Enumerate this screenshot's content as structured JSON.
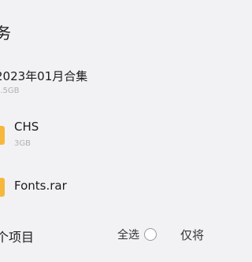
{
  "header": {
    "title": "务"
  },
  "files": [
    {
      "name": "2023年01月合集",
      "size": "7.5GB",
      "icon": "folder-icon"
    },
    {
      "name": "CHS",
      "size": "3GB",
      "icon": "folder-icon"
    },
    {
      "name": "Fonts.rar",
      "size": "",
      "icon": "folder-icon"
    }
  ],
  "footer": {
    "count_label": "个项目",
    "select_all_label": "全选",
    "only_label": "仅将"
  },
  "colors": {
    "background": "#f2f2f4",
    "folder": "#f6b73c",
    "secondary_text": "#b0b0b4"
  }
}
